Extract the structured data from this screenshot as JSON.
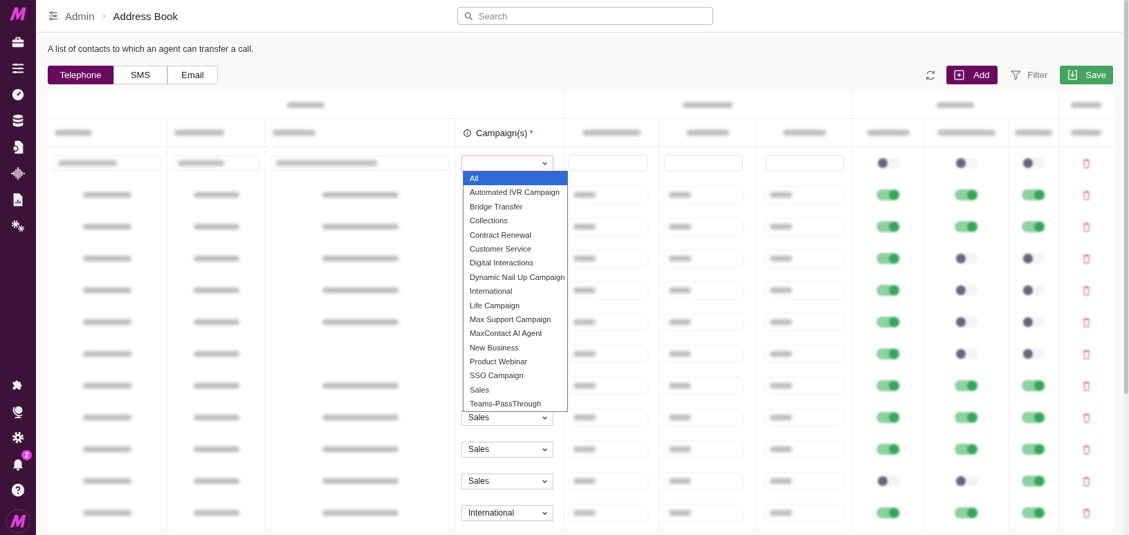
{
  "breadcrumb": {
    "parent": "Admin",
    "current": "Address Book"
  },
  "search": {
    "placeholder": "Search"
  },
  "description": "A list of contacts to which an agent can transfer a call.",
  "tabs": [
    {
      "label": "Telephone",
      "selected": true
    },
    {
      "label": "SMS",
      "selected": false
    },
    {
      "label": "Email",
      "selected": false
    }
  ],
  "toolbar": [
    {
      "kind": "refresh"
    },
    {
      "kind": "add",
      "label": "Add"
    },
    {
      "kind": "filter",
      "label": "Filter"
    },
    {
      "kind": "save",
      "label": "Save"
    }
  ],
  "sidebar": {
    "notification_count": "2"
  },
  "table": {
    "campaign_header": {
      "label": "Campaign(s)",
      "required_mark": "*"
    },
    "rows": [
      {
        "kind": "editing",
        "has_description": true,
        "hold_key": false,
        "rec_conference": false,
        "rec_bridge": false
      },
      {
        "kind": "saved",
        "has_description": true,
        "hold_key": true,
        "rec_conference": true,
        "rec_bridge": true
      },
      {
        "kind": "saved",
        "has_description": true,
        "hold_key": true,
        "rec_conference": true,
        "rec_bridge": true
      },
      {
        "kind": "saved",
        "has_description": true,
        "hold_key": true,
        "rec_conference": false,
        "rec_bridge": false
      },
      {
        "kind": "saved",
        "has_description": true,
        "hold_key": true,
        "rec_conference": false,
        "rec_bridge": false
      },
      {
        "kind": "saved",
        "has_description": true,
        "hold_key": true,
        "rec_conference": false,
        "rec_bridge": false
      },
      {
        "kind": "saved",
        "has_description": false,
        "hold_key": true,
        "rec_conference": false,
        "rec_bridge": false
      },
      {
        "kind": "saved",
        "has_description": true,
        "hold_key": true,
        "rec_conference": true,
        "rec_bridge": true
      },
      {
        "kind": "saved",
        "has_description": true,
        "campaign": "Sales",
        "hold_key": true,
        "rec_conference": true,
        "rec_bridge": true
      },
      {
        "kind": "saved",
        "has_description": true,
        "campaign": "Sales",
        "hold_key": true,
        "rec_conference": true,
        "rec_bridge": true
      },
      {
        "kind": "saved",
        "has_description": true,
        "campaign": "Sales",
        "hold_key": false,
        "rec_conference": false,
        "rec_bridge": true
      },
      {
        "kind": "saved",
        "has_description": true,
        "campaign": "International",
        "hold_key": true,
        "rec_conference": true,
        "rec_bridge": true
      }
    ]
  },
  "campaign_dropdown": {
    "open": true,
    "options": [
      {
        "label": "All",
        "selected": true
      },
      {
        "label": "Automated IVR Campaign",
        "selected": false
      },
      {
        "label": "Bridge Transfer",
        "selected": false
      },
      {
        "label": "Collections",
        "selected": false
      },
      {
        "label": "Contract Renewal",
        "selected": false
      },
      {
        "label": "Customer Service",
        "selected": false
      },
      {
        "label": "Digital Interactions",
        "selected": false
      },
      {
        "label": "Dynamic Nail Up Campaign",
        "selected": false
      },
      {
        "label": "International",
        "selected": false
      },
      {
        "label": "Life Campaign",
        "selected": false
      },
      {
        "label": "Max Support Campaign",
        "selected": false
      },
      {
        "label": "MaxContact AI Agent",
        "selected": false
      },
      {
        "label": "New Business",
        "selected": false
      },
      {
        "label": "Product Webinar",
        "selected": false
      },
      {
        "label": "SSO Campaign",
        "selected": false
      },
      {
        "label": "Sales",
        "selected": false
      },
      {
        "label": "Teams-PassThrough",
        "selected": false
      }
    ]
  }
}
